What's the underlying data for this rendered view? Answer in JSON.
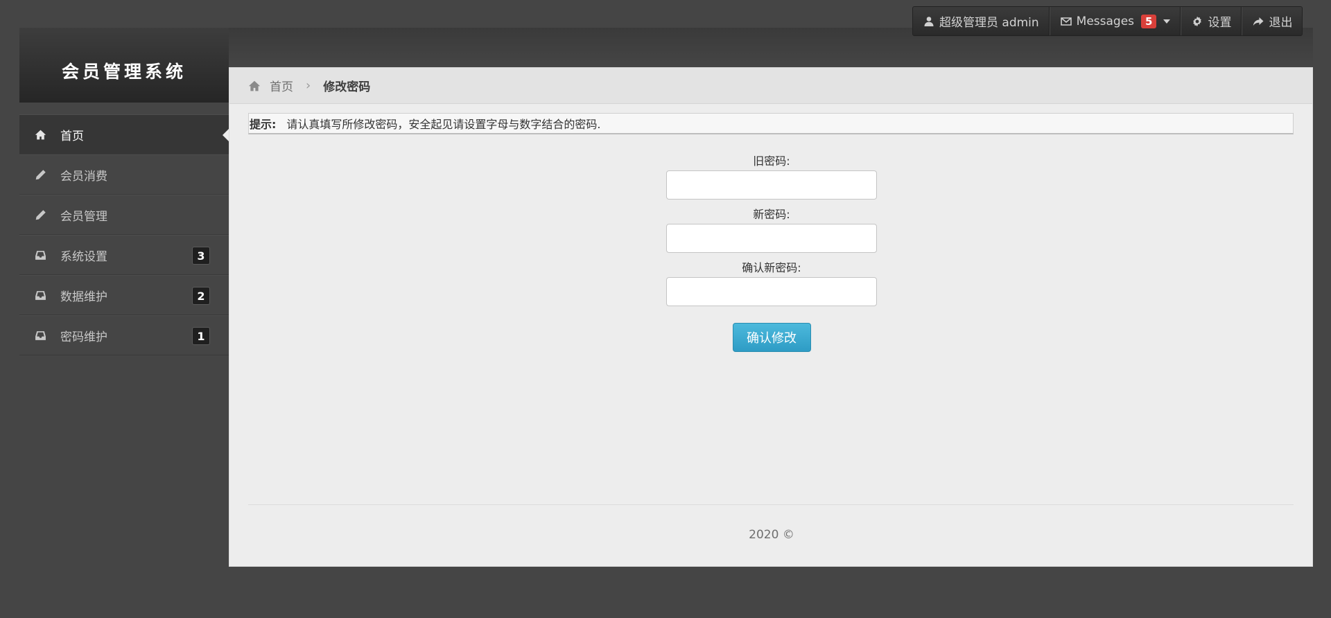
{
  "brand": {
    "title": "会员管理系统"
  },
  "usermenu": {
    "user_label": "超级管理员 admin",
    "messages_label": "Messages",
    "messages_count": "5",
    "settings_label": "设置",
    "logout_label": "退出"
  },
  "sidebar": {
    "items": [
      {
        "label": "首页",
        "icon": "home-icon",
        "badge": ""
      },
      {
        "label": "会员消费",
        "icon": "pencil-icon",
        "badge": ""
      },
      {
        "label": "会员管理",
        "icon": "pencil-icon",
        "badge": ""
      },
      {
        "label": "系统设置",
        "icon": "inbox-icon",
        "badge": "3"
      },
      {
        "label": "数据维护",
        "icon": "inbox-icon",
        "badge": "2"
      },
      {
        "label": "密码维护",
        "icon": "inbox-icon",
        "badge": "1"
      }
    ]
  },
  "breadcrumb": {
    "home": "首页",
    "current": "修改密码"
  },
  "tip": {
    "label": "提示:",
    "text": "请认真填写所修改密码，安全起见请设置字母与数字结合的密码."
  },
  "form": {
    "old_password_label": "旧密码:",
    "old_password_value": "",
    "new_password_label": "新密码:",
    "new_password_value": "",
    "confirm_password_label": "确认新密码:",
    "confirm_password_value": "",
    "submit_label": "确认修改"
  },
  "footer": {
    "text": "2020 ©"
  },
  "colors": {
    "background": "#454545",
    "content_bg": "#ededed",
    "primary_button": "#3aa8d0",
    "messages_badge": "#d9403a"
  }
}
